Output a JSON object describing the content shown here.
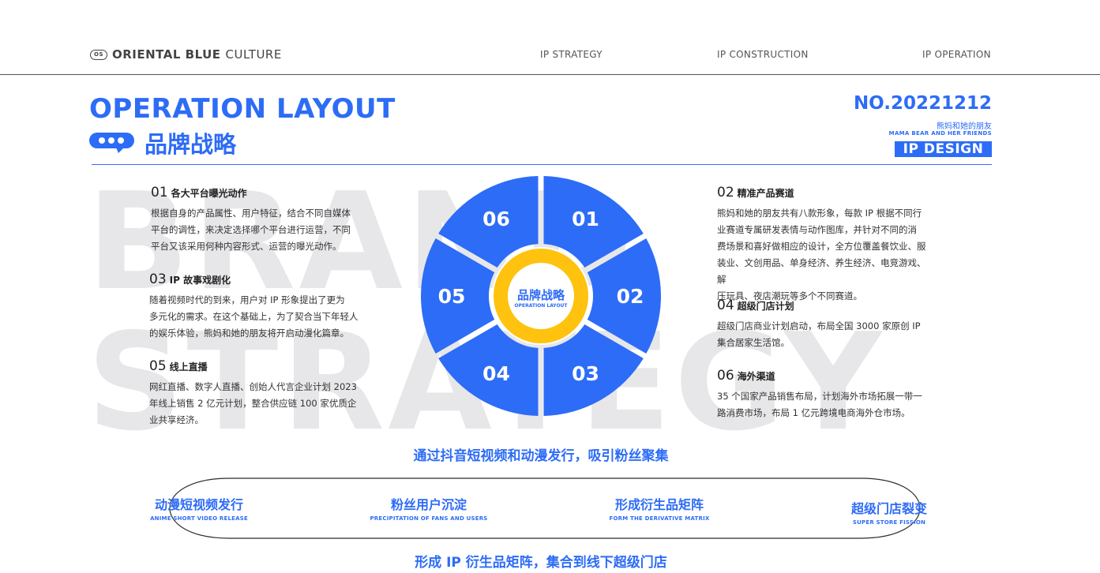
{
  "header": {
    "logo_mark": "OS",
    "brand_bold": "ORIENTAL BLUE",
    "brand_light": "CULTURE",
    "nav": [
      "IP STRATEGY",
      "IP CONSTRUCTION",
      "IP OPERATION"
    ]
  },
  "title": {
    "en": "OPERATION LAYOUT",
    "cn": "品牌战略",
    "number": "NO.20221212",
    "subtitle_cn": "熊妈和她的朋友",
    "subtitle_en": "MAMA BEAR AND HER FRIENDS",
    "badge": "IP DESIGN"
  },
  "background_text": [
    "BRAND",
    "STRATEGY"
  ],
  "left_blocks": [
    {
      "num": "01",
      "title": "各大平台曝光动作",
      "lines": [
        "根据自身的产品属性、用户特征，结合不同自媒体",
        "平台的调性，来决定选择哪个平台进行运营，不同",
        "平台又该采用何种内容形式、运营的曝光动作。"
      ]
    },
    {
      "num": "03",
      "title": "IP 故事戏剧化",
      "lines": [
        "随着视频时代的到来，用户对 IP 形象提出了更为",
        "多元化的需求。在这个基础上，为了契合当下年轻人",
        "的娱乐体验，熊妈和她的朋友将开启动漫化篇章。"
      ]
    },
    {
      "num": "05",
      "title": "线上直播",
      "lines": [
        "网红直播、数字人直播、创始人代言企业计划 2023",
        "年线上销售 2 亿元计划，整合供应链 100 家优质企",
        "业共享经济。"
      ]
    }
  ],
  "right_blocks": [
    {
      "num": "02",
      "title": "精准产品赛道",
      "lines": [
        "熊妈和她的朋友共有八款形象，每款 IP 根据不同行",
        "业赛道专属研发表情与动作图库，并针对不同的消",
        "费场景和喜好做相应的设计，全方位覆盖餐饮业、服",
        "装业、文创用品、单身经济、养生经济、电竞游戏、解",
        "压玩具、夜店潮玩等多个不同赛道。"
      ]
    },
    {
      "num": "04",
      "title": "超级门店计划",
      "lines": [
        "超级门店商业计划启动，布局全国 3000 家原创 IP",
        "集合居家生活馆。"
      ]
    },
    {
      "num": "06",
      "title": "海外渠道",
      "lines": [
        "35 个国家产品销售布局，计划海外市场拓展一带一",
        "路消费市场，布局 1 亿元跨境电商海外仓市场。"
      ]
    }
  ],
  "wheel": {
    "segments": [
      "01",
      "02",
      "03",
      "04",
      "05",
      "06"
    ],
    "center_cn": "品牌战略",
    "center_en": "OPERATION LAYOUT",
    "colors": {
      "segment": "#2d6cf6",
      "ring": "#ffc20e",
      "text": "#ffffff"
    }
  },
  "flow": {
    "top_text": "通过抖音短视频和动漫发行，吸引粉丝聚集",
    "steps": [
      {
        "cn": "动漫短视频发行",
        "en": "ANIME SHORT VIDEO RELEASE"
      },
      {
        "cn": "粉丝用户沉淀",
        "en": "PRECIPITATION OF FANS AND USERS"
      },
      {
        "cn": "形成衍生品矩阵",
        "en": "FORM THE DERIVATIVE MATRIX"
      },
      {
        "cn": "超级门店裂变",
        "en": "SUPER STORE FISSION"
      }
    ],
    "bottom_text": "形成 IP 衍生品矩阵，集合到线下超级门店"
  },
  "accent_color": "#2d6cf6"
}
